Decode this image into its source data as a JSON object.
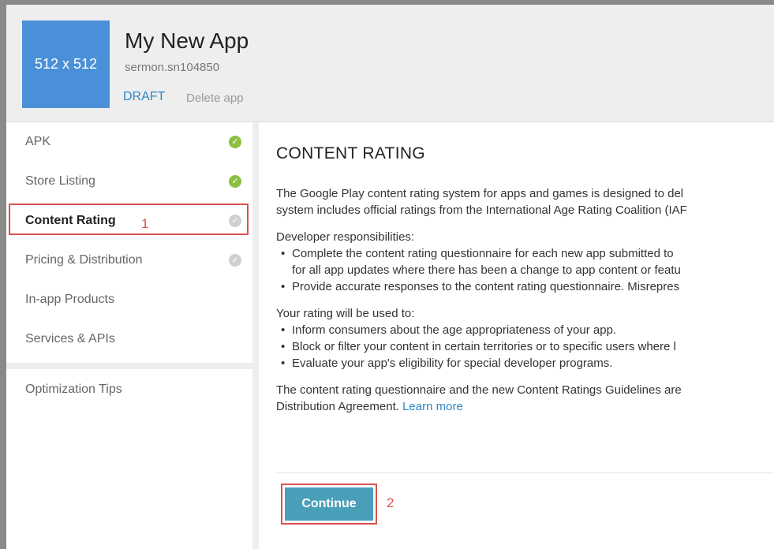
{
  "app": {
    "icon_label": "512 x 512",
    "title": "My New App",
    "package": "sermon.sn104850",
    "status": "DRAFT",
    "delete_label": "Delete app"
  },
  "sidebar": {
    "items": [
      {
        "label": "APK",
        "status": "done"
      },
      {
        "label": "Store Listing",
        "status": "done"
      },
      {
        "label": "Content Rating",
        "status": "pending"
      },
      {
        "label": "Pricing & Distribution",
        "status": "pending"
      },
      {
        "label": "In-app Products",
        "status": "none"
      },
      {
        "label": "Services & APIs",
        "status": "none"
      }
    ],
    "optimization": "Optimization Tips"
  },
  "annotations": {
    "marker_1": "1",
    "marker_2": "2"
  },
  "main": {
    "title": "CONTENT RATING",
    "intro_line1": "The Google Play content rating system for apps and games is designed to del",
    "intro_line2": "system includes official ratings from the International Age Rating Coalition (IAF",
    "resp_heading": "Developer responsibilities:",
    "resp_1_line1": "Complete the content rating questionnaire for each new app submitted to",
    "resp_1_line2": "for all app updates where there has been a change to app content or featu",
    "resp_2": "Provide accurate responses to the content rating questionnaire. Misrepres",
    "use_heading": "Your rating will be used to:",
    "use_1": "Inform consumers about the age appropriateness of your app.",
    "use_2": "Block or filter your content in certain territories or to specific users where l",
    "use_3": "Evaluate your app's eligibility for special developer programs.",
    "outro_line1": "The content rating questionnaire and the new Content Ratings Guidelines are",
    "outro_line2": "Distribution Agreement.",
    "learn_more": "Learn more",
    "continue_label": "Continue"
  },
  "colors": {
    "accent": "#2f86c6",
    "button": "#4a9fb8",
    "highlight": "#d9534f",
    "check_done": "#8dbf3f",
    "check_pending": "#cfcfcf"
  }
}
